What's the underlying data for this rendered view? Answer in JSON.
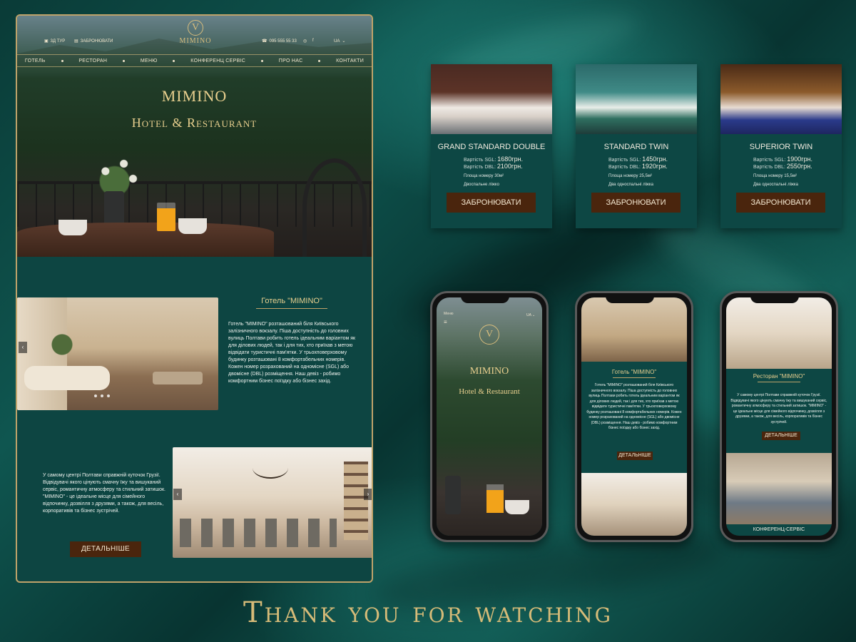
{
  "desktop": {
    "topbar": {
      "tour": "3Д ТУР",
      "book": "ЗАБРОНЮВАТИ",
      "phone": "095 555 55 33",
      "lang": "UA"
    },
    "logo": {
      "letter": "V",
      "name": "MIMINO"
    },
    "nav": [
      "ГОТЕЛЬ",
      "РЕСТОРАН",
      "МЕНЮ",
      "КОНФЕРЕНЦ СЕРВІС",
      "ПРО НАС",
      "КОНТАКТИ"
    ],
    "hero": {
      "title": "MIMINO",
      "subtitle": "Hotel & Restaurant"
    },
    "hotel": {
      "title": "Готель \"MIMINO\"",
      "text": "Готель \"MIMINO\" розташований біля Київського залізничного вокзалу. Піша доступність до головних вулиць Полтави робить готель ідеальним варіантом як для ділових людей, так і для тих, хто приїхав з метою відвідати туристичні пам'ятки. У трьохповерховому будинку розташовані 8 комфортабельних номерів. Кожен номер розрахований на одномісне (SGL) або двомісне (DBL) розміщення. Наш девіз - робимо комфортним бізнес поїздку або бізнес захід."
    },
    "restaurant": {
      "text": "У самому центрі Полтави справжній куточок Грузії. Відвідувачі якого цінують смачну їжу та вишуканий сервіс, романтичну атмосферу та стильний затишок. \"MIMINO\" - це ідеальне місце для сімейного відпочинку, дозвілля з друзями, а також, для весіль, корпоративів та бізнес зустрічей.",
      "button": "ДЕТАЛЬНІШЕ"
    }
  },
  "rooms": [
    {
      "title": "GRAND STANDARD DOUBLE",
      "sgl_label": "Вартість SGL:",
      "sgl": "1680грн.",
      "dbl_label": "Вартість DBL:",
      "dbl": "2100грн.",
      "area": "Площа номеру 30м²",
      "beds": "Двоспальне ліжко",
      "button": "ЗАБРОНЮВАТИ"
    },
    {
      "title": "STANDARD TWIN",
      "sgl_label": "Вартість SGL:",
      "sgl": "1450грн.",
      "dbl_label": "Вартість DBL:",
      "dbl": "1920грн.",
      "area": "Площа номеру 25,5м²",
      "beds": "Два односпальні ліжка",
      "button": "ЗАБРОНЮВАТИ"
    },
    {
      "title": "SUPERIOR TWIN",
      "sgl_label": "Вартість SGL:",
      "sgl": "1900грн.",
      "dbl_label": "Вартість DBL:",
      "dbl": "2550грн.",
      "area": "Площа номеру 15,5м²",
      "beds": "Два односпальні ліжка",
      "button": "ЗАБРОНЮВАТИ"
    }
  ],
  "phones": {
    "p1": {
      "menu": "Меню",
      "lang": "UA",
      "title": "MIMINO",
      "subtitle": "Hotel & Restaurant"
    },
    "p2": {
      "title": "Готель \"MIMINO\"",
      "text": "Готель \"MIMINO\" розташований біля Київського залізничного вокзалу. Піша доступність до головних вулиць Полтави робить готель ідеальним варіантом як для ділових людей, так і для тих, хто приїхав з метою відвідати туристичні пам'ятки. У трьохповерховому будинку розташовані 8 комфортабельних номерів. Кожен номер розрахований на одномісне (SGL) або двомісне (DBL) розміщення. Наш девіз - робимо комфортним бізнес поїздку або бізнес захід.",
      "button": "ДЕТАЛЬНІШЕ"
    },
    "p3": {
      "title": "Ресторан \"MIMINO\"",
      "text": "У самому центрі Полтави справжній куточок Грузії. Відвідувачі якого цінують смачну їжу та вишуканий сервіс, романтичну атмосферу та стильний затишок. \"MIMINO\" - це ідеальне місце для сімейного відпочинку, дозвілля з друзями, а також, для весіль, корпоративів та бізнес зустрічей.",
      "button": "ДЕТАЛЬНІШЕ",
      "footer": "КОНФЕРЕНЦ-СЕРВІС"
    }
  },
  "footer": {
    "thanks": "Thank you for watching"
  },
  "colors": {
    "accent": "#d8bd7d",
    "button": "#4a250d",
    "panel": "#0d4744"
  }
}
